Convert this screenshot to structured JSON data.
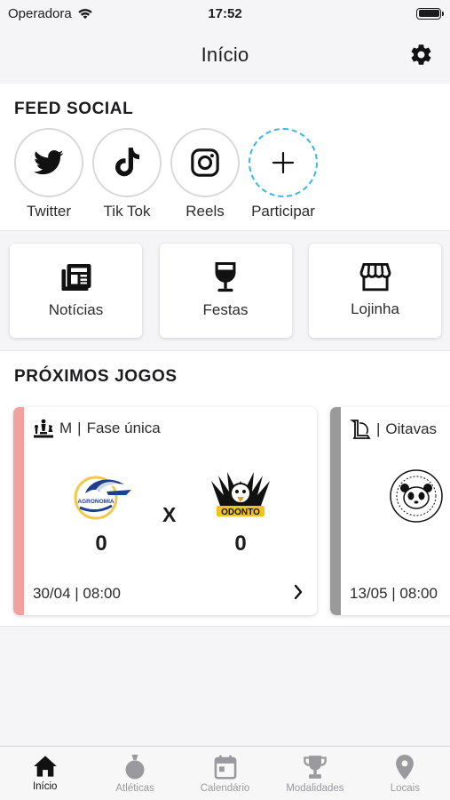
{
  "status_bar": {
    "carrier": "Operadora",
    "time": "17:52"
  },
  "nav": {
    "title": "Início",
    "settings_icon": "gear-icon"
  },
  "social": {
    "title": "FEED SOCIAL",
    "items": [
      {
        "label": "Twitter",
        "icon": "twitter-icon"
      },
      {
        "label": "Tik Tok",
        "icon": "tiktok-icon"
      },
      {
        "label": "Reels",
        "icon": "instagram-icon"
      },
      {
        "label": "Participar",
        "icon": "plus-icon"
      }
    ]
  },
  "quick_links": [
    {
      "label": "Notícias",
      "icon": "newspaper-icon"
    },
    {
      "label": "Festas",
      "icon": "wine-glass-icon"
    },
    {
      "label": "Lojinha",
      "icon": "store-icon"
    }
  ],
  "games": {
    "title": "PRÓXIMOS JOGOS",
    "items": [
      {
        "category": "M",
        "phase": "Fase única",
        "sport_icon": "chess-icon",
        "accent": "#f2a19c",
        "home_team_logo": "agronomia-logo",
        "away_team_logo": "odonto-logo",
        "home_text": "AGRONOMIA",
        "away_text": "ODONTO",
        "home_score": "0",
        "away_score": "0",
        "vs": "X",
        "date": "30/04 | 08:00"
      },
      {
        "category": "",
        "phase": "Oitavas",
        "sport_icon": "league-of-legends-icon",
        "accent": "#9a9a9a",
        "home_team_logo": "panda-logo",
        "date": "13/05 | 08:00"
      }
    ]
  },
  "tabs": [
    {
      "label": "Início",
      "icon": "home-icon",
      "active": true
    },
    {
      "label": "Atléticas",
      "icon": "medal-icon",
      "active": false
    },
    {
      "label": "Calendário",
      "icon": "calendar-icon",
      "active": false
    },
    {
      "label": "Modalidades",
      "icon": "trophy-icon",
      "active": false
    },
    {
      "label": "Locais",
      "icon": "location-pin-icon",
      "active": false
    }
  ]
}
